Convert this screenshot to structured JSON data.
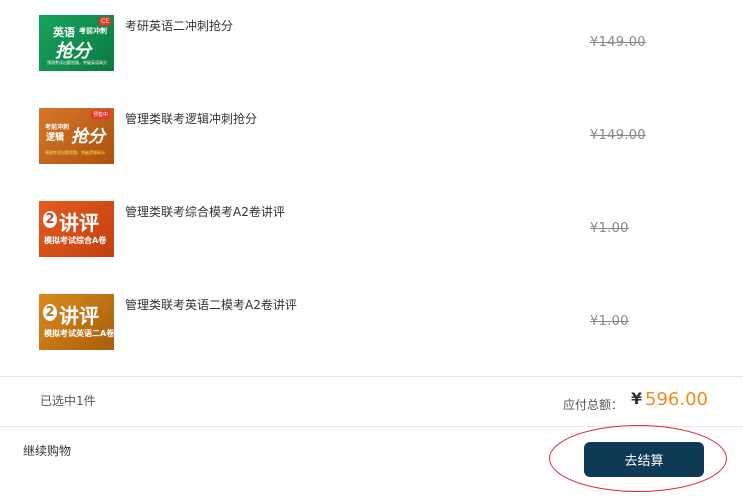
{
  "items": [
    {
      "title": "考研英语二冲刺抢分",
      "price": "¥149.00",
      "thumb": {
        "line1": "英语",
        "line1b": "考前冲刺",
        "line2": "抢分",
        "line3": "预测考试出题思路，突破英语高分",
        "badge": "CE",
        "colors": [
          "#159a58",
          "#0c7a43"
        ]
      }
    },
    {
      "title": "管理类联考逻辑冲刺抢分",
      "price": "¥149.00",
      "thumb": {
        "line1": "考前冲刺",
        "line1b": "逻辑",
        "line2": "抢分",
        "line3": "预测考试出题思路，突破逻辑高分",
        "badge": "预售中",
        "colors": [
          "#d2701f",
          "#a9520f"
        ]
      }
    },
    {
      "title": "管理类联考综合模考A2卷讲评",
      "price": "¥1.00",
      "thumb": {
        "line1": "2",
        "line1b": "",
        "line2": "讲评",
        "line3": "模拟考试综合A卷",
        "badge": "",
        "colors": [
          "#e2561c",
          "#c1400f"
        ]
      }
    },
    {
      "title": "管理类联考英语二模考A2卷讲评",
      "price": "¥1.00",
      "thumb": {
        "line1": "2",
        "line1b": "",
        "line2": "讲评",
        "line3": "模拟考试英语二A卷",
        "badge": "",
        "colors": [
          "#d58417",
          "#a85f0c"
        ]
      }
    }
  ],
  "summary": {
    "selected": "已选中1件",
    "total_label": "应付总额：",
    "currency": "¥",
    "total": "596.00"
  },
  "footer": {
    "continue": "继续购物",
    "checkout": "去结算"
  },
  "colors": {
    "accent_price": "#f08c1e",
    "checkout_bg": "#0e3a56",
    "annotation_ring": "#e0243a"
  }
}
